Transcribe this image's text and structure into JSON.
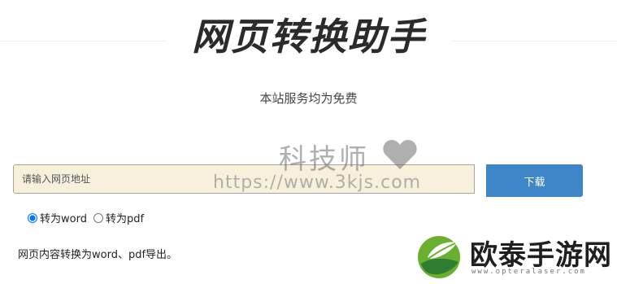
{
  "header": {
    "title": "网页转换助手",
    "subtitle": "本站服务均为免费"
  },
  "form": {
    "url_placeholder": "请输入网页地址",
    "url_value": "",
    "download_label": "下载",
    "options": [
      {
        "label": "转为word",
        "selected": true
      },
      {
        "label": "转为pdf",
        "selected": false
      }
    ]
  },
  "description": "网页内容转换为word、pdf导出。",
  "watermark": {
    "name": "科技师",
    "url": "https://www.3kjs.com",
    "heart_color": "#6e6e6e"
  },
  "brand": {
    "name": "欧泰手游网",
    "url": "www.opteralaser.com",
    "green": "#6ab02e",
    "dark_green": "#2e7d32"
  },
  "colors": {
    "button": "#3f86c8",
    "input_bg": "#f7f0dc"
  }
}
